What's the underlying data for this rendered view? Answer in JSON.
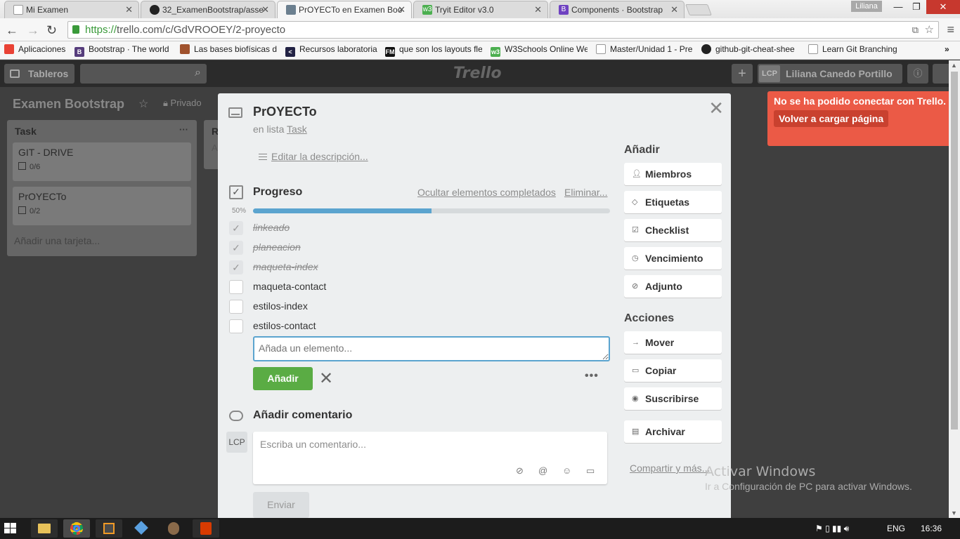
{
  "browser": {
    "tabs": [
      {
        "title": "Mi Examen",
        "favicon": "doc-icon",
        "color": "#888888"
      },
      {
        "title": "32_ExamenBootstrap/asse",
        "favicon": "github-icon",
        "color": "#222222"
      },
      {
        "title": "PrOYECTo en Examen Boo",
        "favicon": "trello-icon",
        "color": "#6b7f8f",
        "active": true
      },
      {
        "title": "Tryit Editor v3.0",
        "favicon": "w3-icon",
        "color": "#4caf50"
      },
      {
        "title": "Components · Bootstrap",
        "favicon": "bootstrap-icon",
        "color": "#6f42c1"
      }
    ],
    "window_user": "Liliana",
    "url_https": "https://",
    "url_rest": "trello.com/c/GdVROOEY/2-proyecto",
    "bookmarks": [
      {
        "label": "Aplicaciones",
        "icon": "apps-icon",
        "color": "#e94235"
      },
      {
        "label": "Bootstrap · The world",
        "icon": "bootstrap-icon",
        "color": "#563d7c"
      },
      {
        "label": "Las bases biofísicas de",
        "icon": "person-icon",
        "color": "#a0522d"
      },
      {
        "label": "Recursos laboratoria",
        "icon": "code-icon",
        "color": "#222244"
      },
      {
        "label": "que son los layouts fle",
        "icon": "fm-icon",
        "color": "#111111"
      },
      {
        "label": "W3Schools Online We",
        "icon": "w3-icon",
        "color": "#4caf50"
      },
      {
        "label": "Master/Unidad 1 - Pre",
        "icon": "page-icon",
        "color": "#bbbbbb"
      },
      {
        "label": "github-git-cheat-shee",
        "icon": "github-icon",
        "color": "#222222"
      },
      {
        "label": "Learn Git Branching",
        "icon": "page-icon",
        "color": "#bbbbbb"
      }
    ]
  },
  "trello_header": {
    "boards": "Tableros",
    "logo": "Trello",
    "user_initials": "LCP",
    "user_name": "Liliana Canedo Portillo"
  },
  "board": {
    "title": "Examen Bootstrap",
    "visibility": "Privado",
    "lists": [
      {
        "name": "Task",
        "cards": [
          {
            "title": "GIT - DRIVE",
            "badge": "0/6"
          },
          {
            "title": "PrOYECTo",
            "badge": "0/2"
          }
        ],
        "add_card": "Añadir una tarjeta..."
      },
      {
        "name": "R",
        "peek": "A"
      }
    ]
  },
  "card_modal": {
    "title": "PrOYECTo",
    "in_list_prefix": "en lista",
    "list_name": "Task",
    "edit_description": "Editar la descripción...",
    "checklist": {
      "title": "Progreso",
      "hide_completed": "Ocultar elementos completados",
      "delete": "Eliminar...",
      "percent_label": "50%",
      "progress": 0.5,
      "items": [
        {
          "text": "linkeado",
          "done": true
        },
        {
          "text": "planeacion",
          "done": true
        },
        {
          "text": "maqueta-index",
          "done": true
        },
        {
          "text": "maqueta-contact",
          "done": false
        },
        {
          "text": "estilos-index",
          "done": false
        },
        {
          "text": "estilos-contact",
          "done": false
        }
      ],
      "new_item_placeholder": "Añada un elemento...",
      "add_button": "Añadir"
    },
    "comment": {
      "title": "Añadir comentario",
      "avatar": "LCP",
      "placeholder": "Escriba un comentario...",
      "send": "Enviar"
    },
    "sidebar": {
      "add_heading": "Añadir",
      "add_buttons": [
        {
          "label": "Miembros",
          "icon": "person-icon"
        },
        {
          "label": "Etiquetas",
          "icon": "tag-icon"
        },
        {
          "label": "Checklist",
          "icon": "checkbox-icon"
        },
        {
          "label": "Vencimiento",
          "icon": "clock-icon"
        },
        {
          "label": "Adjunto",
          "icon": "paperclip-icon"
        }
      ],
      "actions_heading": "Acciones",
      "action_buttons": [
        {
          "label": "Mover",
          "icon": "arrow-right-icon"
        },
        {
          "label": "Copiar",
          "icon": "card-icon"
        },
        {
          "label": "Suscribirse",
          "icon": "eye-icon"
        },
        {
          "label": "Archivar",
          "icon": "archive-icon"
        }
      ],
      "share": "Compartir y más..."
    }
  },
  "alert": {
    "message": "No se ha podido conectar con Trello.",
    "reload": "Volver a cargar página",
    "color": "#eb5a46"
  },
  "watermark": {
    "line1": "Activar Windows",
    "line2": "Ir a Configuración de PC para activar Windows."
  },
  "taskbar": {
    "language": "ENG",
    "time": "16:36"
  }
}
